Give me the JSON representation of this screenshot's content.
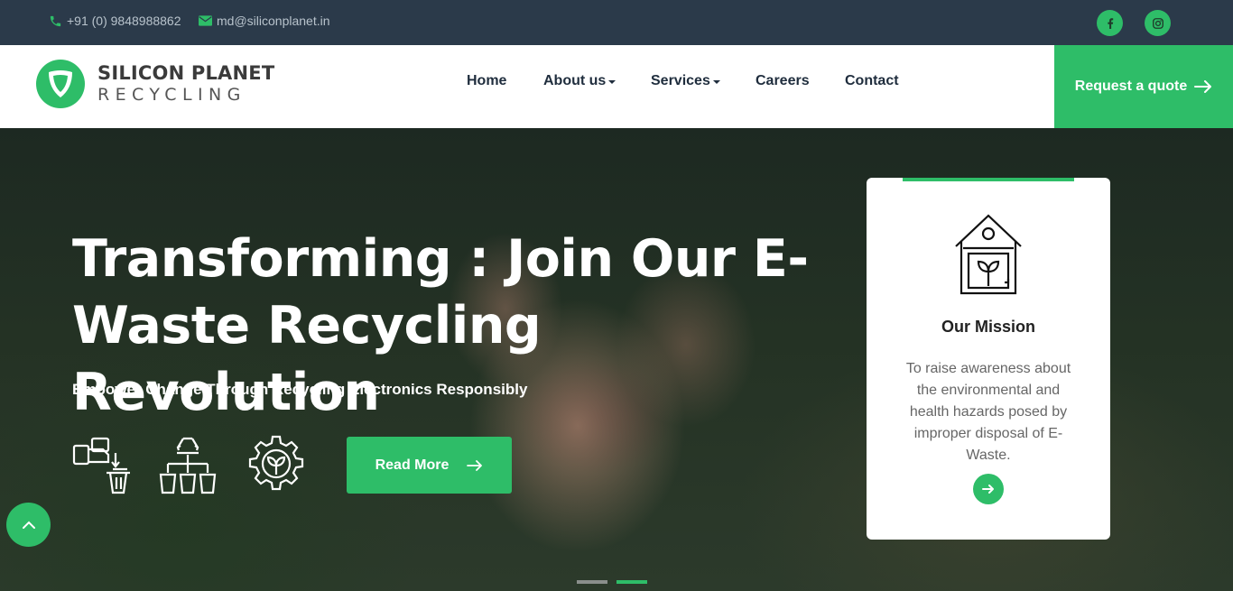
{
  "topbar": {
    "phone": "+91 (0) 9848988862",
    "email": "md@siliconplanet.in",
    "social": [
      "facebook-icon",
      "instagram-icon"
    ]
  },
  "brand": {
    "line1": "SILICON PLANET",
    "line2": "RECYCLING"
  },
  "nav": {
    "items": [
      {
        "label": "Home",
        "dropdown": false
      },
      {
        "label": "About us",
        "dropdown": true
      },
      {
        "label": "Services",
        "dropdown": true
      },
      {
        "label": "Careers",
        "dropdown": false
      },
      {
        "label": "Contact",
        "dropdown": false
      }
    ],
    "quote_label": "Request a quote"
  },
  "hero": {
    "title": "Transforming : Join Our E-Waste Recycling Revolution",
    "subtitle": "Empower Change Through Recycling Electronics Responsibly",
    "read_more": "Read More",
    "icons": [
      "dispose-electronics-icon",
      "recycling-sort-icon",
      "eco-gear-icon"
    ]
  },
  "mission": {
    "title": "Our Mission",
    "text": "To raise awareness about the environmental and health hazards posed by improper disposal of E-Waste."
  },
  "slider": {
    "count": 2,
    "active_index": 1
  },
  "colors": {
    "accent": "#2ebd68",
    "topbar": "#2b3a4a",
    "nav_text": "#1f2d3d"
  }
}
